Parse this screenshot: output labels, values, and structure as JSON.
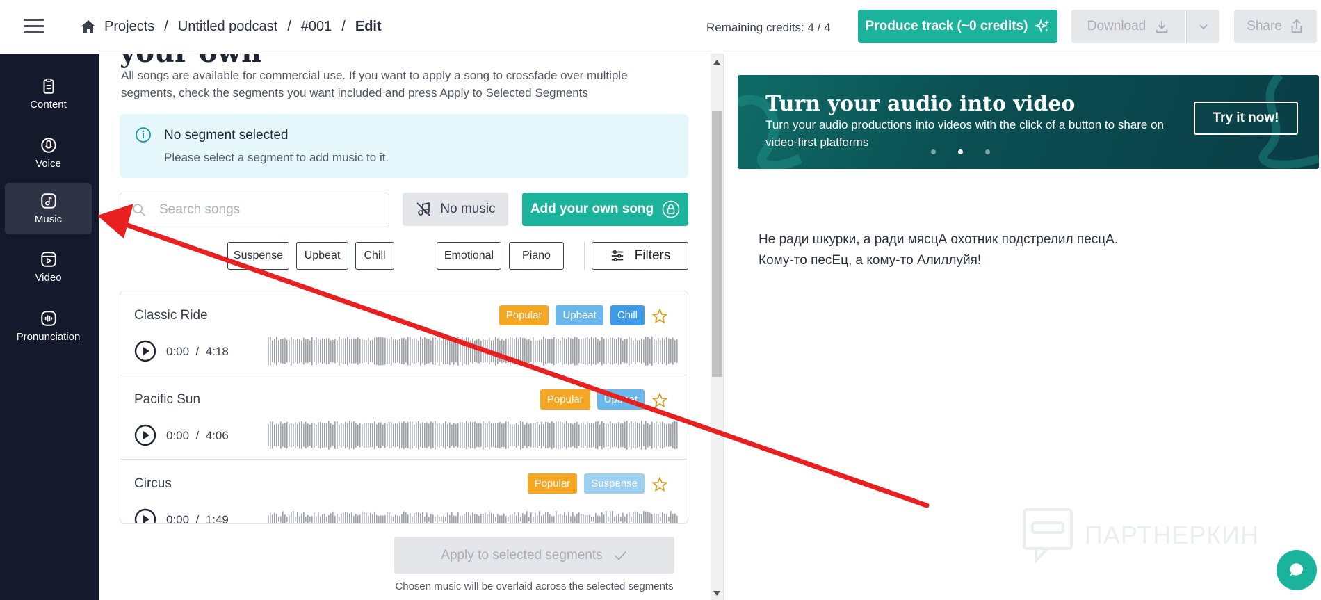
{
  "header": {
    "breadcrumb": [
      "Projects",
      "Untitled podcast",
      "#001",
      "Edit"
    ],
    "separator": "/",
    "credits": "Remaining credits: 4 / 4",
    "produce_label": "Produce track (~0 credits)",
    "download_label": "Download",
    "share_label": "Share"
  },
  "sidebar": {
    "items": [
      {
        "label": "Content",
        "icon": "content-icon"
      },
      {
        "label": "Voice",
        "icon": "voice-icon"
      },
      {
        "label": "Music",
        "icon": "music-icon",
        "active": true
      },
      {
        "label": "Video",
        "icon": "video-icon"
      },
      {
        "label": "Pronunciation",
        "icon": "pronunciation-icon"
      }
    ]
  },
  "music": {
    "heading_partial": "your own",
    "intro": "All songs are available for commercial use. If you want to apply a song to crossfade over multiple segments, check the segments you want included and press Apply to Selected Segments",
    "notice_title": "No segment selected",
    "notice_body": "Please select a segment to add music to it.",
    "search_placeholder": "Search songs",
    "no_music_label": "No music",
    "add_song_label": "Add your own song",
    "chips": [
      "Suspense",
      "Upbeat",
      "Chill",
      "Emotional",
      "Piano"
    ],
    "filters_label": "Filters",
    "songs": [
      {
        "title": "Classic Ride",
        "time": "0:00",
        "duration": "4:18",
        "tags": [
          "Popular",
          "Upbeat",
          "Chill"
        ]
      },
      {
        "title": "Pacific Sun",
        "time": "0:00",
        "duration": "4:06",
        "tags": [
          "Popular",
          "Upbeat"
        ]
      },
      {
        "title": "Circus",
        "time": "0:00",
        "duration": "1:49",
        "tags": [
          "Popular",
          "Suspense"
        ]
      }
    ],
    "time_sep": "/",
    "apply_label": "Apply to selected segments",
    "apply_note": "Chosen music will be overlaid across the selected segments"
  },
  "banner": {
    "title": "Turn your audio into video",
    "subtitle": "Turn your audio productions into videos with the click of a button to share on video-first platforms",
    "cta": "Try it now!"
  },
  "script": {
    "line1": "Не ради шкурки, а ради мясцА охотник подстрелил песцА.",
    "line2": "Кому-то песЕц, а кому-то Алиллуйя!"
  },
  "watermark": "ПАРТНЕРКИН",
  "colors": {
    "accent": "#1bb39b",
    "sidebar_bg": "#141a2c",
    "tag_popular": "#f5a623",
    "tag_upbeat": "#6ab7ec",
    "tag_chill": "#3d9be9",
    "tag_suspense": "#9ed0f2",
    "annotation_arrow": "#e8201f"
  }
}
